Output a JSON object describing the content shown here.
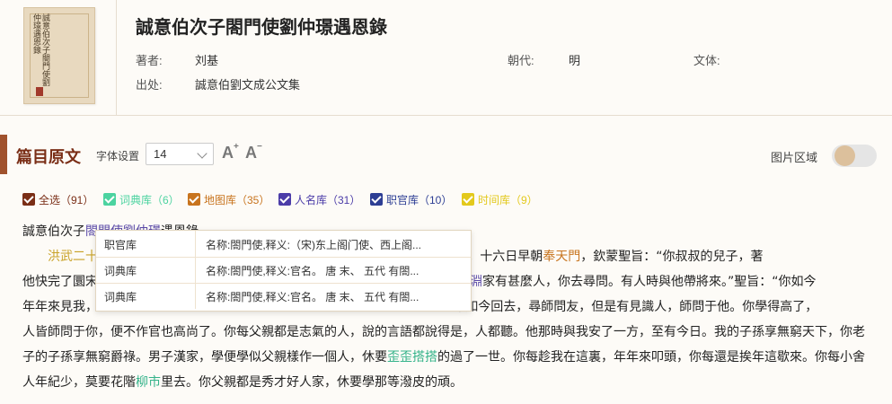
{
  "book": {
    "cover_title": "誠意伯次子閤門使劉仲璟遇恩錄",
    "title": "誠意伯次子閤門使劉仲璟遇恩錄",
    "author_label": "著者:",
    "author": "刘基",
    "dynasty_label": "朝代:",
    "dynasty": "明",
    "style_label": "文体:",
    "style": "",
    "source_label": "出处:",
    "source": "誠意伯劉文成公文集"
  },
  "toolbar": {
    "section_title": "篇目原文",
    "font_label": "字体设置",
    "font_size": "14",
    "increase_label": "A",
    "decrease_label": "A",
    "image_area_label": "图片区域"
  },
  "filters": [
    {
      "label": "全选（91）",
      "color": "#7a2e16"
    },
    {
      "label": "词典库（6）",
      "color": "#4cd3a0"
    },
    {
      "label": "地图库（35）",
      "color": "#c8741e"
    },
    {
      "label": "人名库（31）",
      "color": "#4b3ca8"
    },
    {
      "label": "职官库（10）",
      "color": "#2d3e94"
    },
    {
      "label": "时间库（9）",
      "color": "#e3c91c"
    }
  ],
  "text": {
    "line1_a": "誠意伯次子",
    "line1_b": "閤門使劉仲璟",
    "line1_c": "遇恩錄",
    "line2_a": "洪武二十",
    "line2_b": "去”，每日來見。十六日早朝",
    "line2_c": "奉天門",
    "line2_d": "，欽蒙聖旨：“你叔叔的兒子，著",
    "line3_a": "他快完了圜宋",
    "line3_b": "葉景淵",
    "line3_c": "家有甚麼人，你去尋問。有人時與他帶將來。”聖旨：“你如今",
    "line4_a": "年年來見我，",
    "line4_b": "：“你如今回去，尋師問友，但是有見識人，師問于他。你學得高了，",
    "line5": "人皆師問于你，便不作官也高尚了。你每父親都是志氣的人，說的言語都說得是，人都聽。他那時與我安了一方，至有今日。我的子孫享無窮天下，你老",
    "line6_a": "子的子孫享無窮爵祿。男子漢家，學便學似父親樣作一個人，休要",
    "line6_b": "歪歪搭搭",
    "line6_c": "的過了一世。你每趁我在這裏，年年來叩頭，你每還是挨年這歇來。你每小舍",
    "line7_a": "人年紀少，莫要花階",
    "line7_b": "柳市",
    "line7_c": "里去。你父親都是秀才好人家，休要學那等潑皮的頑。"
  },
  "popup": {
    "rows": [
      {
        "category": "职官库",
        "content": "名称:閤門使,释义:（宋)东上阁门使、西上阁..."
      },
      {
        "category": "词典库",
        "content": "名称:閤門使,释义:官名。 唐 末、 五代 有閤..."
      },
      {
        "category": "词典库",
        "content": "名称:閤門使,释义:官名。 唐 末、 五代 有閤..."
      }
    ]
  },
  "colors": {
    "accent": "#a0522d",
    "section_title": "#7a2e16",
    "toggle_knob": "#dcc09c"
  }
}
